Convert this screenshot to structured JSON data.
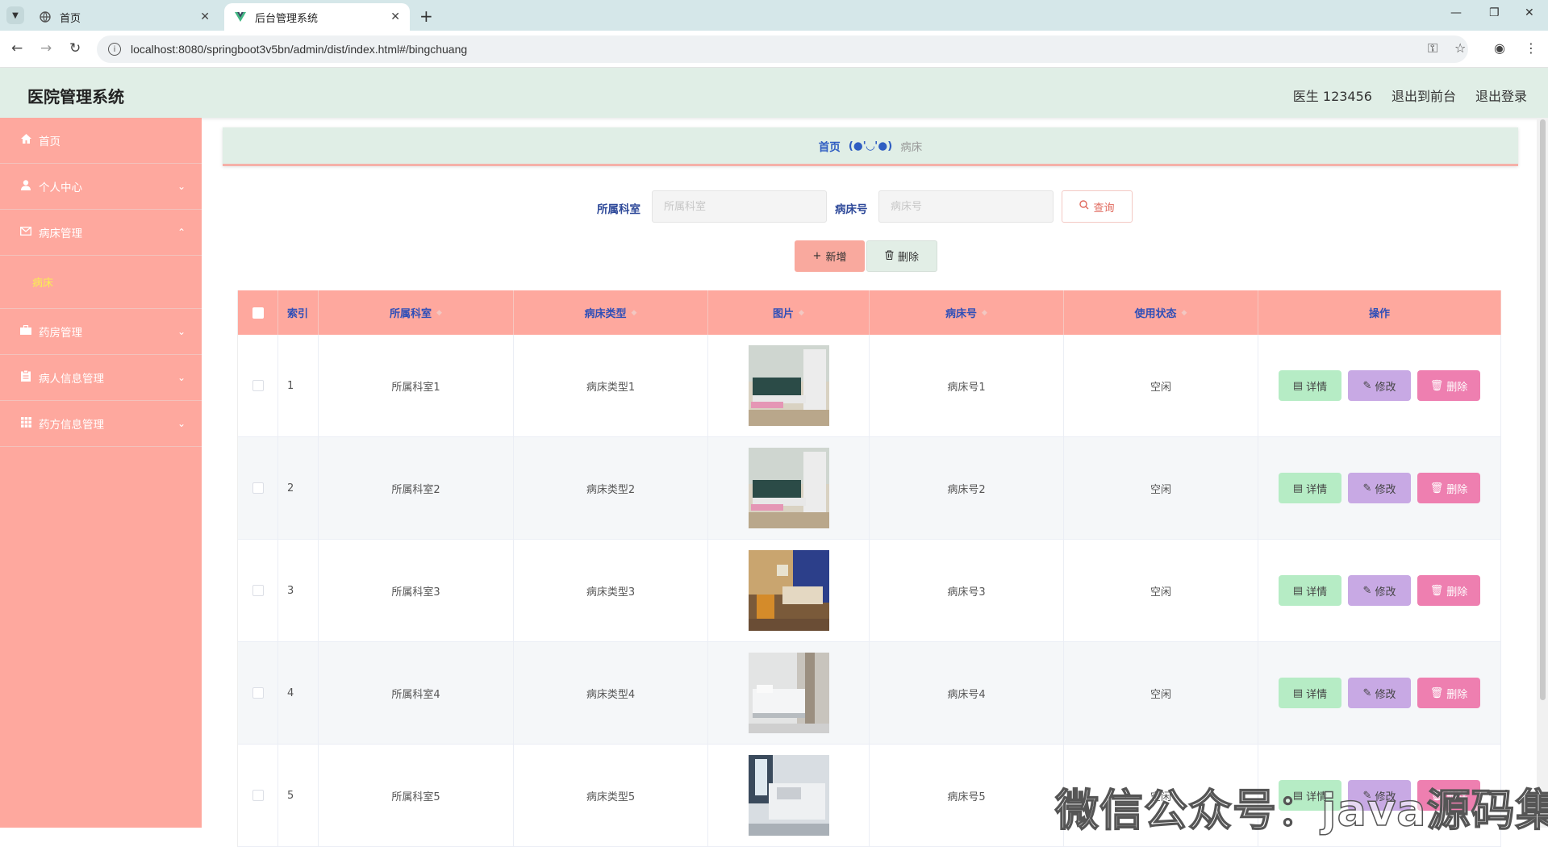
{
  "browser": {
    "tabs": [
      {
        "title": "首页",
        "icon": "globe-icon"
      },
      {
        "title": "后台管理系统",
        "icon": "vue-logo-icon"
      }
    ],
    "url": "localhost:8080/springboot3v5bn/admin/dist/index.html#/bingchuang"
  },
  "header": {
    "title": "医院管理系统",
    "user": "医生 123456",
    "back_to_front": "退出到前台",
    "logout": "退出登录"
  },
  "sidebar": {
    "items": [
      {
        "label": "首页",
        "icon": "home-icon"
      },
      {
        "label": "个人中心",
        "icon": "user-icon",
        "arrow": "down"
      },
      {
        "label": "病床管理",
        "icon": "mail-icon",
        "arrow": "up"
      },
      {
        "label": "药房管理",
        "icon": "briefcase-icon",
        "arrow": "down"
      },
      {
        "label": "病人信息管理",
        "icon": "clipboard-icon",
        "arrow": "down"
      },
      {
        "label": "药方信息管理",
        "icon": "grid-icon",
        "arrow": "down"
      }
    ],
    "submenu": {
      "label": "病床"
    }
  },
  "breadcrumb": {
    "home": "首页",
    "separator": "(●'◡'●)",
    "current": "病床"
  },
  "search": {
    "dept_label": "所属科室",
    "dept_placeholder": "所属科室",
    "bed_label": "病床号",
    "bed_placeholder": "病床号",
    "query": "查询"
  },
  "actions": {
    "add": "新增",
    "delete": "删除"
  },
  "table": {
    "columns": {
      "index": "索引",
      "dept": "所属科室",
      "type": "病床类型",
      "image": "图片",
      "bed_no": "病床号",
      "status": "使用状态",
      "ops": "操作"
    },
    "rows": [
      {
        "index": "1",
        "dept": "所属科室1",
        "type": "病床类型1",
        "bed_no": "病床号1",
        "status": "空闲"
      },
      {
        "index": "2",
        "dept": "所属科室2",
        "type": "病床类型2",
        "bed_no": "病床号2",
        "status": "空闲"
      },
      {
        "index": "3",
        "dept": "所属科室3",
        "type": "病床类型3",
        "bed_no": "病床号3",
        "status": "空闲"
      },
      {
        "index": "4",
        "dept": "所属科室4",
        "type": "病床类型4",
        "bed_no": "病床号4",
        "status": "空闲"
      },
      {
        "index": "5",
        "dept": "所属科室5",
        "type": "病床类型5",
        "bed_no": "病床号5",
        "status": "空闲"
      }
    ],
    "op_labels": {
      "detail": "详情",
      "edit": "修改",
      "delete": "删除"
    }
  },
  "watermark": "微信公众号：java源码集合",
  "colors": {
    "sidebar": "#fea89e",
    "header": "#e0eee6",
    "link": "#2f5dc2",
    "detail_btn": "#b6ecc5",
    "edit_btn": "#c8a9e4",
    "delete_btn": "#ee7fb0"
  }
}
